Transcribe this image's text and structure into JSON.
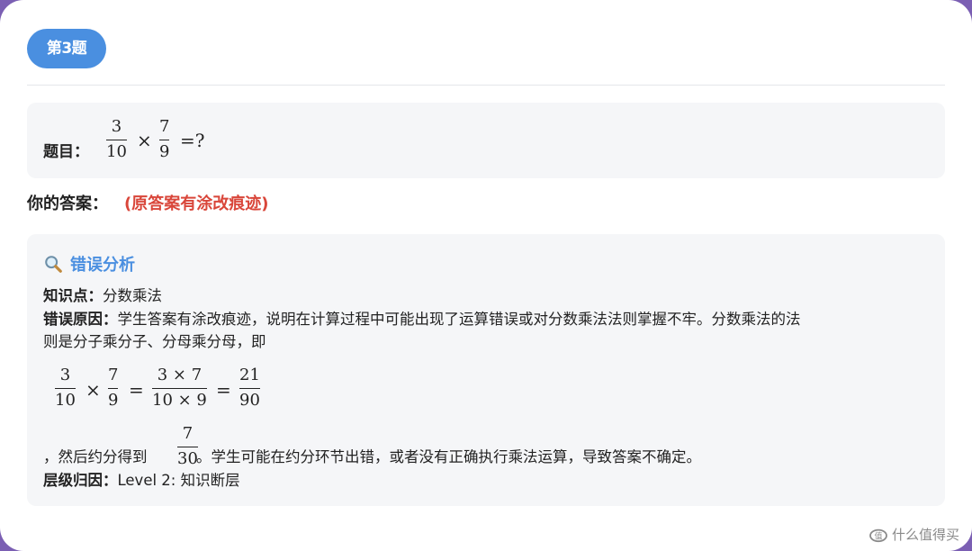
{
  "header": {
    "badge": "第3题"
  },
  "question": {
    "label": "题目：",
    "expr": {
      "a_num": "3",
      "a_den": "10",
      "times": "×",
      "b_num": "7",
      "b_den": "9",
      "equals_q": "=?"
    }
  },
  "answer": {
    "label": "你的答案：",
    "value": "(原答案有涂改痕迹)"
  },
  "analysis": {
    "icon": "magnifier-icon",
    "title": "错误分析",
    "knowledge_label": "知识点：",
    "knowledge_value": "分数乘法",
    "error_label": "错误原因：",
    "error_line1": "学生答案有涂改痕迹，说明在计算过程中可能出现了运算错误或对分数乘法法则掌握不牢。分数乘法的法",
    "error_line2": "则是分子乘分子、分母乘分母，即",
    "formula": {
      "a_num": "3",
      "a_den": "10",
      "times": "×",
      "b_num": "7",
      "b_den": "9",
      "eq": "=",
      "c_num": "3 × 7",
      "c_den": "10 × 9",
      "eq2": "=",
      "d_num": "21",
      "d_den": "90"
    },
    "after_prefix": "，然后约分得到",
    "simplified": {
      "num": "7",
      "den": "30"
    },
    "after_suffix": "。学生可能在约分环节出错，或者没有正确执行乘法运算，导致答案不确定。",
    "level_label": "层级归因：",
    "level_value": "Level 2: 知识断层"
  },
  "watermark": {
    "text": "什么值得买",
    "icon": "smzdm-logo-icon"
  },
  "colors": {
    "accent": "#4a8fe0",
    "error": "#d9463a",
    "panel": "#f5f6f8",
    "frame": "#7b5fb3"
  }
}
